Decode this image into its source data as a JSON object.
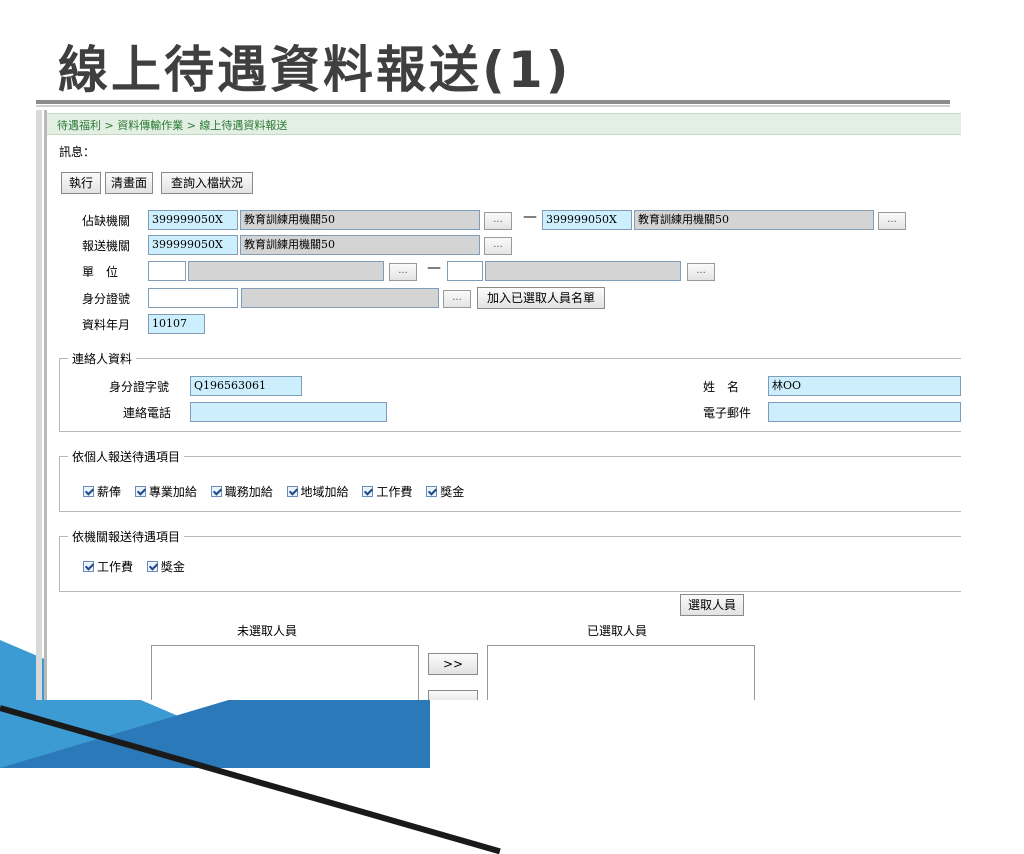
{
  "slide": {
    "title": "線上待遇資料報送(1)"
  },
  "breadcrumb": "待遇福利 > 資料傳輸作業 > 線上待遇資料報送",
  "message_label": "訊息：",
  "toolbar": {
    "execute": "執行",
    "clear": "清畫面",
    "query_status": "查詢入檔狀況"
  },
  "form": {
    "vacancy_org": {
      "label": "佔缺機關",
      "code_from": "399999050X",
      "name_from": "教育訓練用機關50",
      "code_to": "399999050X",
      "name_to": "教育訓練用機關50"
    },
    "report_org": {
      "label": "報送機關",
      "code": "399999050X",
      "name": "教育訓練用機關50"
    },
    "unit": {
      "label": "單　位",
      "code_from": "",
      "name_from": "",
      "code_to": "",
      "name_to": ""
    },
    "id_no": {
      "label": "身分證號",
      "value": "",
      "name": ""
    },
    "add_selected_button": "加入已選取人員名單",
    "data_month": {
      "label": "資料年月",
      "value": "10107"
    },
    "range_dash": "—",
    "browse": "..."
  },
  "contact": {
    "legend": "連絡人資料",
    "id_label": "身分證字號",
    "id_value": "Q196563061",
    "name_label": "姓　名",
    "name_value": "林OO",
    "phone_label": "連絡電話",
    "phone_value": "",
    "email_label": "電子郵件",
    "email_value": ""
  },
  "personal_items": {
    "legend": "依個人報送待遇項目",
    "items": [
      "薪俸",
      "專業加給",
      "職務加給",
      "地域加給",
      "工作費",
      "獎金"
    ]
  },
  "org_items": {
    "legend": "依機關報送待遇項目",
    "items": [
      "工作費",
      "獎金"
    ]
  },
  "people": {
    "select_button": "選取人員",
    "unselected_label": "未選取人員",
    "selected_label": "已選取人員",
    "move_right": ">>"
  }
}
